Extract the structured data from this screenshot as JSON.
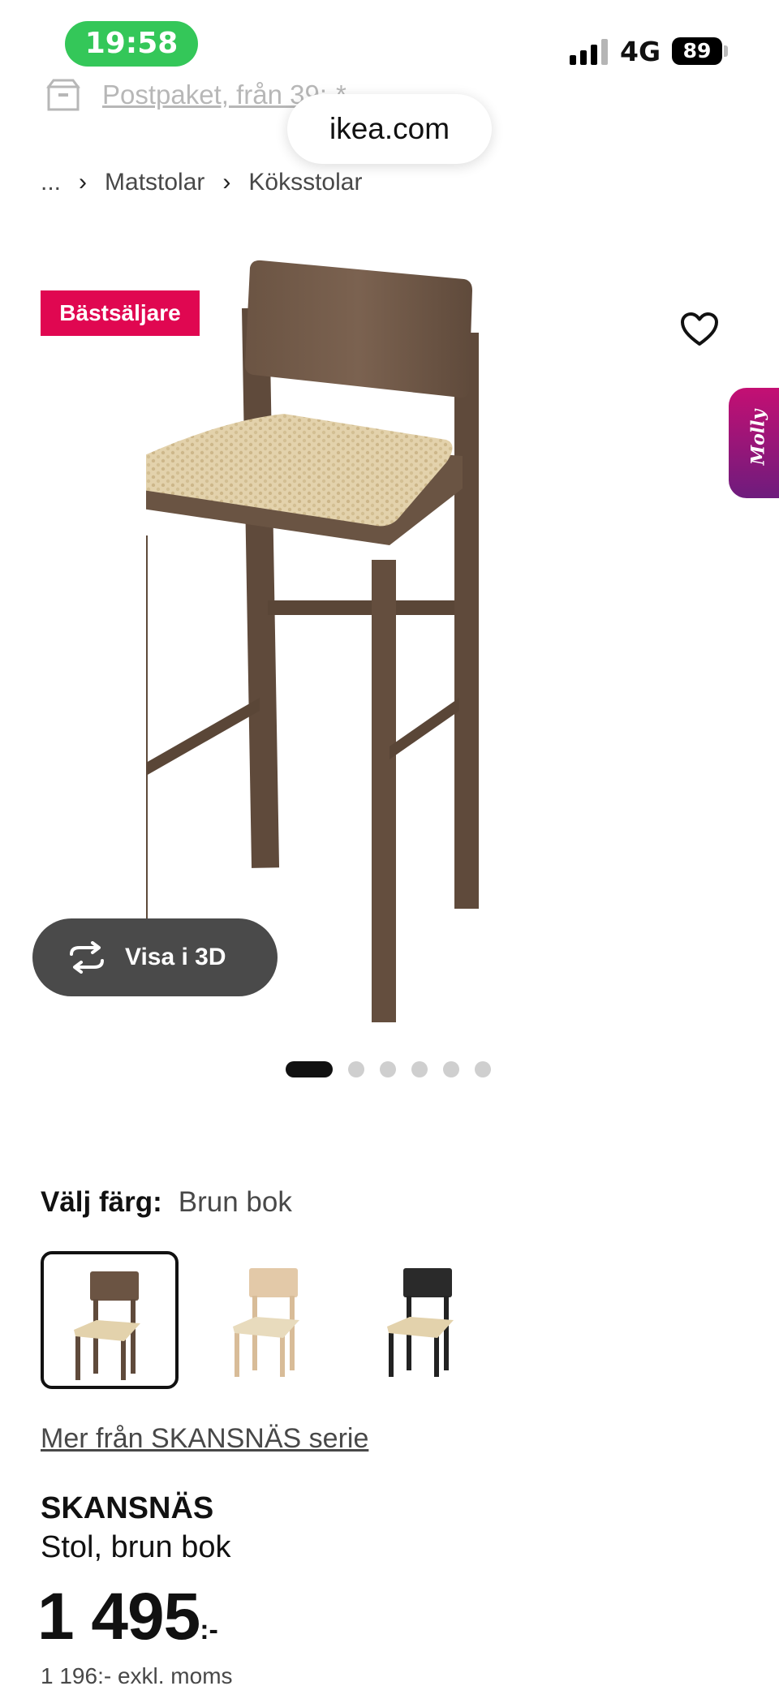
{
  "status_bar": {
    "time": "19:58",
    "network": "4G",
    "battery": "89"
  },
  "promo": {
    "text": "Postpaket, från 39:-*"
  },
  "browser": {
    "url": "ikea.com"
  },
  "breadcrumb": {
    "ellipsis": "...",
    "items": [
      "Matstolar",
      "Köksstolar"
    ]
  },
  "product_image": {
    "badge": "Bästsäljare",
    "assistant_label": "Molly",
    "view3d_label": "Visa i 3D",
    "carousel": {
      "count": 6,
      "active": 1
    }
  },
  "color_select": {
    "label": "Välj färg:",
    "selected": "Brun bok",
    "options": [
      "brown",
      "natural",
      "black"
    ]
  },
  "series_link": "Mer från SKANSNÄS serie",
  "product": {
    "name": "SKANSNÄS",
    "description": "Stol, brun bok",
    "price_number": "1 495",
    "price_suffix": ":-",
    "price_ex_vat": "1 196:- exkl. moms"
  },
  "colors": {
    "badge": "#e00751",
    "assistant": "#c40f73",
    "status_green": "#34c759"
  }
}
